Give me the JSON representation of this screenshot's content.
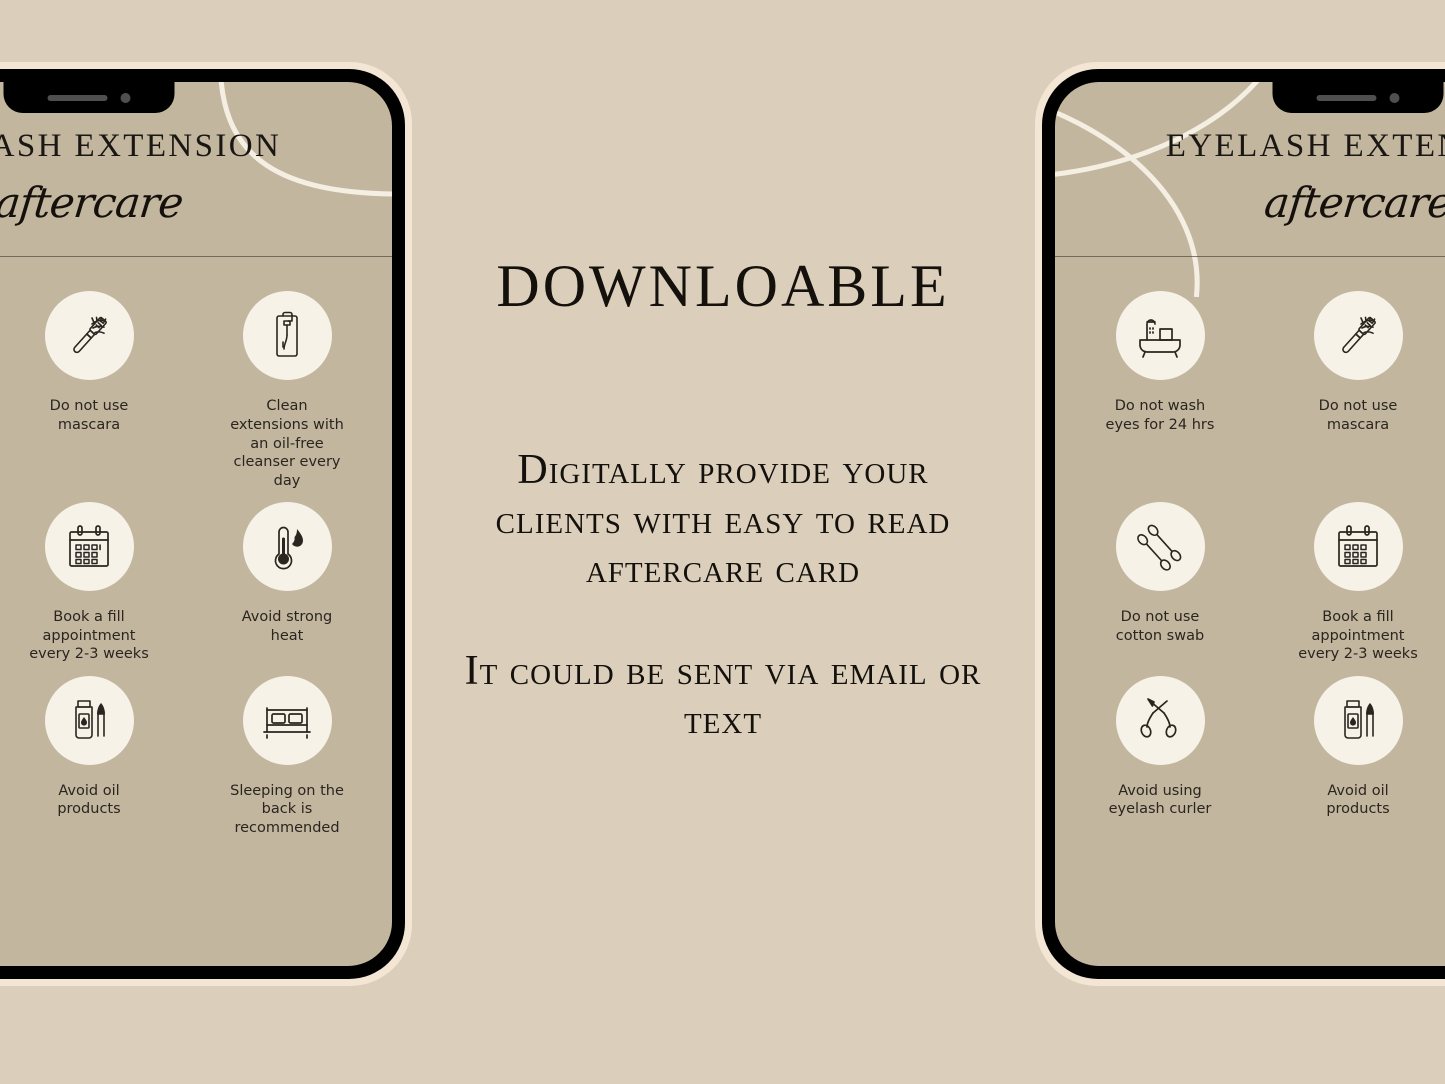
{
  "background_color": "#dbcfbc",
  "screen_color": "#c2b69e",
  "circle_color": "#f7f2e8",
  "center": {
    "headline": "DOWNLOABLE",
    "paragraph_1": "Digitally provide your clients with easy to read aftercare card",
    "paragraph_2": "It could be sent via email or text"
  },
  "card": {
    "title": "EYELASH EXTENSION",
    "script": "aftercare",
    "items": [
      {
        "icon": "bathtub-shower-icon",
        "label": "Do not wash eyes for 24 hrs"
      },
      {
        "icon": "mascara-wand-lashes-icon",
        "label": "Do not use mascara"
      },
      {
        "icon": "cleanser-bottle-icon",
        "label": "Clean extensions with an oil-free cleanser every day"
      },
      {
        "icon": "cotton-swab-icon",
        "label": "Do not use cotton swab"
      },
      {
        "icon": "calendar-icon",
        "label": "Book a fill appointment every 2-3 weeks"
      },
      {
        "icon": "thermometer-flame-icon",
        "label": "Avoid strong heat"
      },
      {
        "icon": "eyelash-curler-icon",
        "label": "Avoid using eyelash curler"
      },
      {
        "icon": "oil-bottle-dropper-icon",
        "label": "Avoid oil products"
      },
      {
        "icon": "bed-icon",
        "label": "Sleeping on the back is recommended"
      }
    ]
  },
  "phones": [
    {
      "name": "phone-left"
    },
    {
      "name": "phone-right"
    }
  ]
}
